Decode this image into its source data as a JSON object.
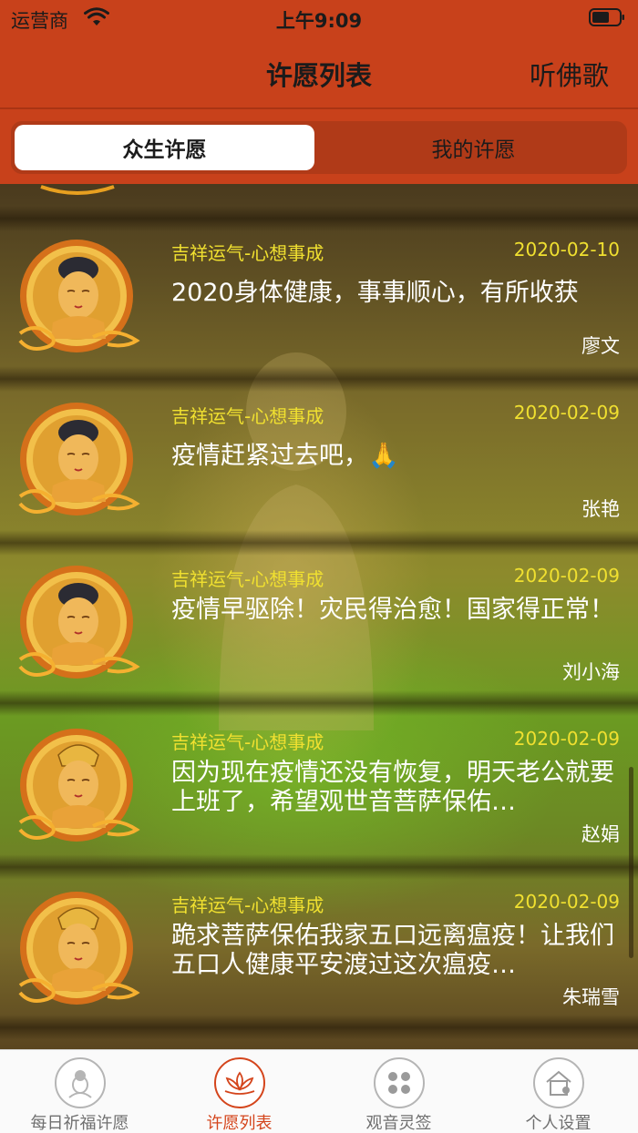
{
  "status_bar": {
    "carrier": "运营商",
    "time": "上午9:09"
  },
  "nav": {
    "title": "许愿列表",
    "right_action": "听佛歌"
  },
  "segments": {
    "public": "众生许愿",
    "mine": "我的许愿"
  },
  "wishes": [
    {
      "category": "吉祥运气-心想事成",
      "date": "2020-02-10",
      "content": "2020身体健康，事事顺心，有所收获",
      "author": "廖文",
      "avatar": "buddha-avatar"
    },
    {
      "category": "吉祥运气-心想事成",
      "date": "2020-02-09",
      "content": "疫情赶紧过去吧，🙏",
      "author": "张艳",
      "avatar": "buddha-avatar"
    },
    {
      "category": "吉祥运气-心想事成",
      "date": "2020-02-09",
      "content": "疫情早驱除！灾民得治愈！国家得正常！",
      "author": "刘小海",
      "avatar": "buddha-avatar"
    },
    {
      "category": "吉祥运气-心想事成",
      "date": "2020-02-09",
      "content": "因为现在疫情还没有恢复，明天老公就要上班了，希望观世音菩萨保佑…",
      "author": "赵娟",
      "avatar": "guanyin-avatar"
    },
    {
      "category": "吉祥运气-心想事成",
      "date": "2020-02-09",
      "content": "跪求菩萨保佑我家五口远离瘟疫！让我们五口人健康平安渡过这次瘟疫…",
      "author": "朱瑞雪",
      "avatar": "guanyin-avatar"
    }
  ],
  "tabbar": {
    "items": [
      {
        "label": "每日祈福许愿",
        "icon": "buddha-head-icon"
      },
      {
        "label": "许愿列表",
        "icon": "lotus-icon"
      },
      {
        "label": "观音灵签",
        "icon": "four-dots-icon"
      },
      {
        "label": "个人设置",
        "icon": "house-person-icon"
      }
    ],
    "active_index": 1
  },
  "colors": {
    "header": "#c8411b",
    "accent": "#d4451c",
    "category_text": "#f0e030"
  }
}
